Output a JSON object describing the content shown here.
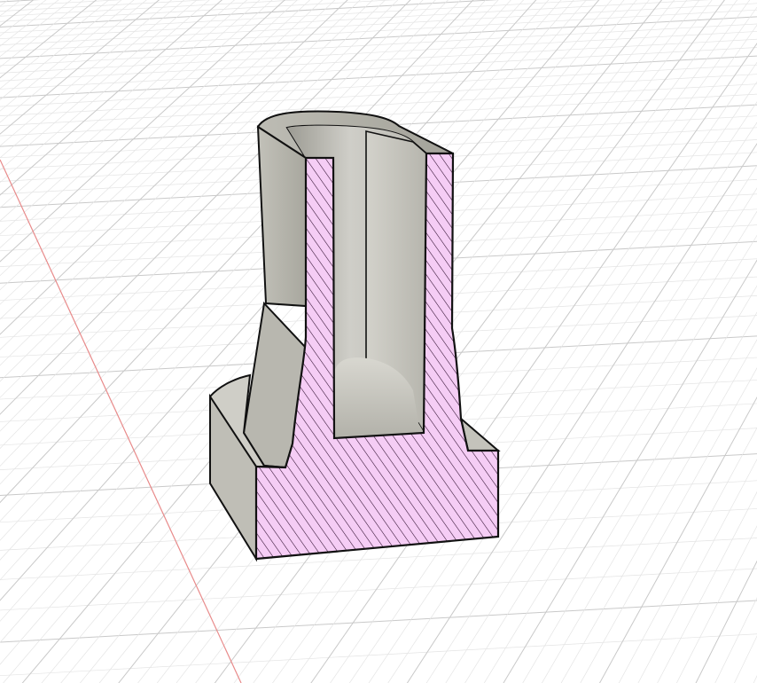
{
  "viewport": {
    "background": "#ffffff",
    "grid_color_major": "#c9c9c9",
    "grid_color_minor": "#e4e4e4",
    "axis_color": "#e88a8a"
  },
  "model": {
    "face_color": "#c6c5be",
    "face_shadow": "#a9a89f",
    "face_light": "#e4e3dd",
    "section_fill": "#f5cdf5",
    "hatch_color": "#2a0a2a",
    "edge_color": "#111111"
  }
}
